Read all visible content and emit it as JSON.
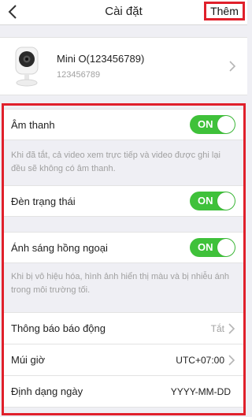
{
  "nav": {
    "title": "Cài đặt",
    "add_label": "Thêm",
    "back_icon": "chevron-left-icon"
  },
  "device": {
    "name": "Mini O(123456789)",
    "serial": "123456789",
    "icon": "camera-icon"
  },
  "settings": {
    "sound": {
      "label": "Âm thanh",
      "toggle": "ON",
      "description": "Khi đã tắt, cả video xem trực tiếp và video được ghi lại đều sẽ không có âm thanh."
    },
    "status_light": {
      "label": "Đèn trạng thái",
      "toggle": "ON"
    },
    "infrared": {
      "label": "Ánh sáng hồng ngoại",
      "toggle": "ON",
      "description": "Khi bị vô hiệu hóa, hình ảnh hiển thị màu và bị nhiễu ánh trong môi trường tối."
    },
    "alarm_notification": {
      "label": "Thông báo báo động",
      "value": "Tắt"
    },
    "timezone": {
      "label": "Múi giờ",
      "value": "UTC+07:00"
    },
    "date_format": {
      "label": "Định dạng ngày",
      "value": "YYYY-MM-DD"
    }
  },
  "colors": {
    "toggle_on": "#3fc13a",
    "highlight": "#e0202b",
    "background": "#efeff4"
  }
}
